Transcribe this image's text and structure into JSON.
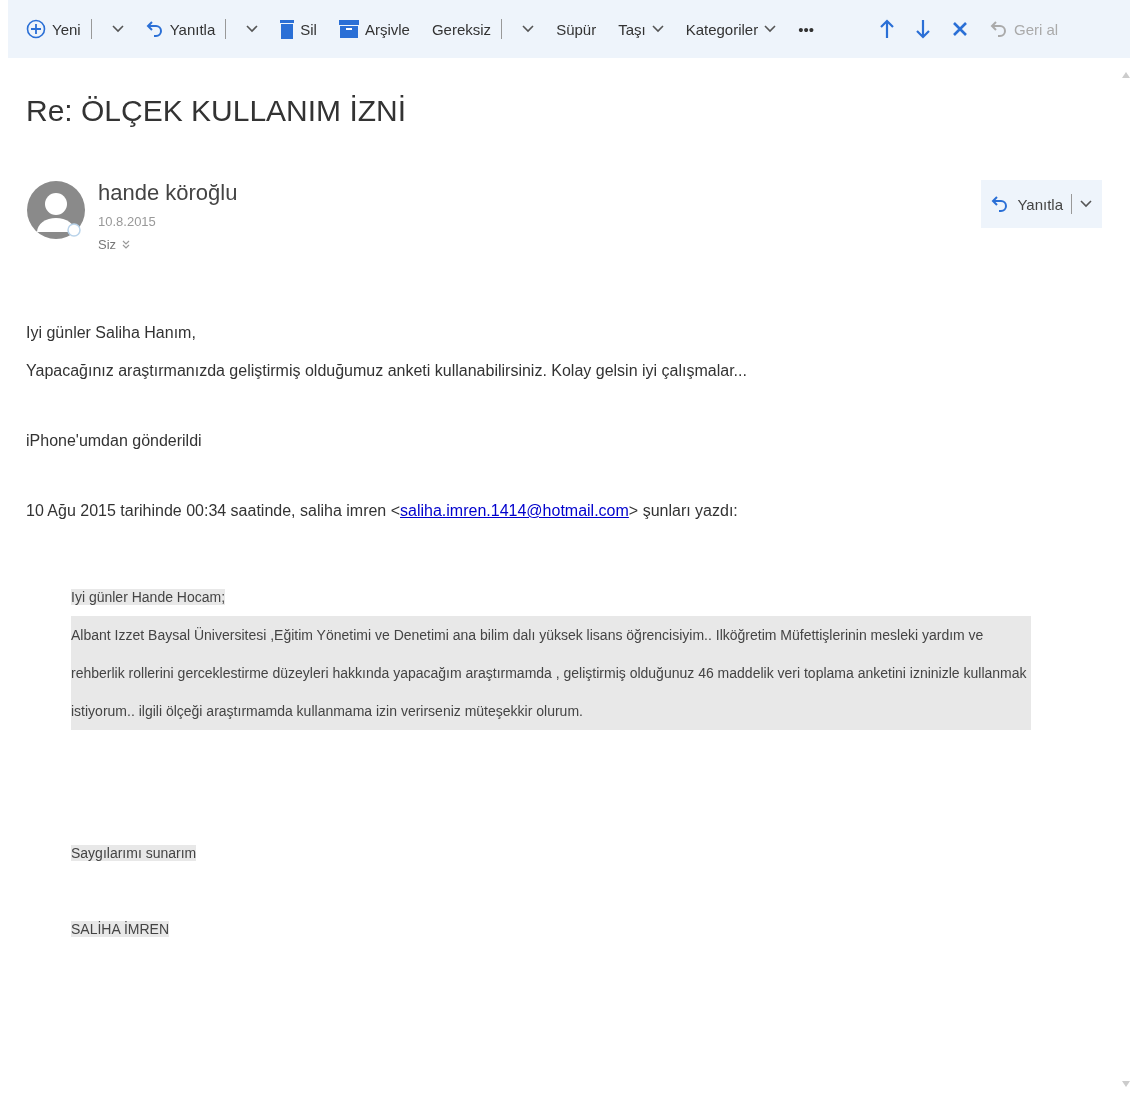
{
  "toolbar": {
    "items": [
      {
        "kind": "new",
        "label": "Yeni",
        "split": true,
        "disabled": false
      },
      {
        "kind": "reply",
        "label": "Yanıtla",
        "split": true,
        "disabled": false
      },
      {
        "kind": "delete",
        "label": "Sil",
        "split": false,
        "disabled": false
      },
      {
        "kind": "archive",
        "label": "Arşivle",
        "split": false,
        "disabled": false
      },
      {
        "kind": "text",
        "label": "Gereksiz",
        "split": true,
        "disabled": false
      },
      {
        "kind": "text",
        "label": "Süpür",
        "split": false,
        "disabled": false
      },
      {
        "kind": "menu",
        "label": "Taşı",
        "split": false,
        "disabled": false
      },
      {
        "kind": "menu",
        "label": "Kategoriler",
        "split": false,
        "disabled": false
      },
      {
        "kind": "more",
        "label": "•••",
        "split": false,
        "disabled": false
      }
    ],
    "nav": [
      {
        "kind": "up",
        "disabled": false
      },
      {
        "kind": "down",
        "disabled": false
      },
      {
        "kind": "close",
        "disabled": false
      },
      {
        "kind": "undo",
        "label": "Geri al",
        "disabled": true
      }
    ]
  },
  "message": {
    "subject": "Re: ÖLÇEK KULLANIM İZNİ",
    "sender": {
      "name": "hande köroğlu",
      "date": "10.8.2015",
      "recipients": "Siz"
    },
    "reply_button": {
      "label": "Yanıtla"
    },
    "body": [
      "Iyi günler Saliha Hanım,",
      "Yapacağınız araştırmanızda geliştirmiş olduğumuz anketi kullanabilirsiniz. Kolay gelsin iyi çalışmalar..."
    ],
    "signature": "iPhone'umdan gönderildi",
    "quote_header": {
      "prefix": "10 Ağu 2015 tarihinde 00:34 saatinde, saliha imren <",
      "link": "saliha.imren.1414@hotmail.com",
      "suffix": "> şunları yazdı:"
    },
    "quoted": {
      "greeting": "Iyi günler Hande Hocam;",
      "paragraph": "Albant Izzet Baysal Üniversitesi ,Eğitim Yönetimi ve Denetimi ana bilim dalı yüksek lisans öğrencisiyim.. Ilköğretim Müfettişlerinin mesleki yardım ve rehberlik rollerini gerceklestirme düzeyleri hakkında yapacağım araştırmamda , geliştirmiş olduğunuz 46 maddelik veri toplama anketini izninizle kullanmak istiyorum.. ilgili ölçeği araştırmamda kullanmama izin verirseniz müteşekkir olurum.",
      "closing": "Saygılarımı sunarım",
      "name": "SALİHA İMREN"
    }
  }
}
